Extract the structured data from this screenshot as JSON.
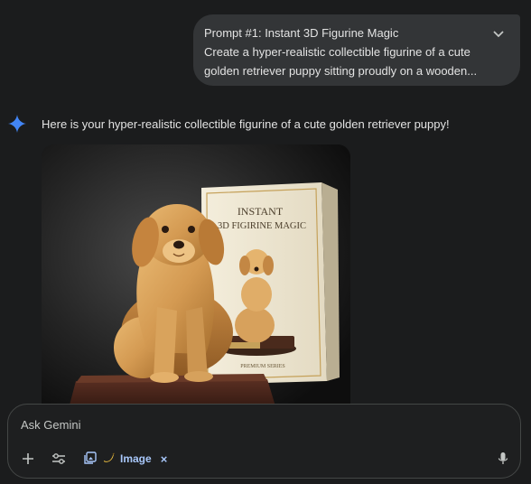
{
  "prompt": {
    "title": "Prompt #1: Instant 3D Figurine Magic",
    "line2": "Create a hyper-realistic collectible figurine of a cute",
    "line3": "golden retriever puppy sitting proudly on a wooden..."
  },
  "response": {
    "text": "Here is your hyper-realistic collectible figurine of a cute golden retriever puppy!"
  },
  "image": {
    "box_title_1": "INSTANT",
    "box_title_2": "3D FIGIRINE MAGIC",
    "box_footer": "PREMIUM SERIES"
  },
  "input": {
    "placeholder": "Ask Gemini",
    "tool_chip_label": "Image",
    "chip_close": "×"
  },
  "colors": {
    "background": "#1b1c1d",
    "bubble": "#333537",
    "accent": "#a8c7fa",
    "spark": "#4285f4"
  },
  "icons": {
    "chevron": "chevron-down-icon",
    "spark": "gemini-spark-icon",
    "add": "plus-icon",
    "tools": "tune-icon",
    "image_chip": "image-gallery-icon",
    "mic": "microphone-icon"
  }
}
